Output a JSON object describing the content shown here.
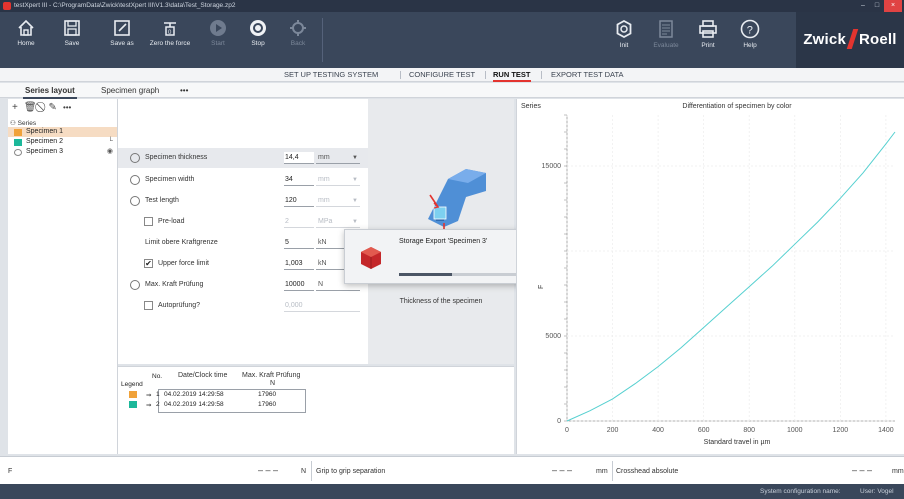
{
  "window": {
    "title": "testXpert III - C:\\ProgramData\\Zwick\\testXpert III\\V1.3\\data\\Test_Storage.zp2",
    "minimize": "–",
    "maximize": "□",
    "close": "×"
  },
  "toolbar": {
    "home": "Home",
    "save": "Save",
    "save_as": "Save as",
    "zero_force": "Zero the force",
    "start": "Start",
    "stop": "Stop",
    "back": "Back",
    "init": "Init",
    "evaluate": "Evaluate",
    "print": "Print",
    "help": "Help",
    "brand_left": "Zwick",
    "brand_right": "Roell"
  },
  "nav": {
    "tabs": [
      {
        "label": "SET UP TESTING SYSTEM"
      },
      {
        "label": "CONFIGURE TEST"
      },
      {
        "label": "RUN TEST"
      },
      {
        "label": "EXPORT TEST DATA"
      }
    ],
    "active": "RUN TEST"
  },
  "subtabs": {
    "series_layout": "Series layout",
    "specimen_graph": "Specimen graph",
    "more": "•••"
  },
  "tree": {
    "root": "Series",
    "items": [
      {
        "label": "Specimen 1",
        "color": "#f0a23a"
      },
      {
        "label": "Specimen 2",
        "color": "#1cb89a"
      },
      {
        "label": "Specimen 3",
        "color": "#ffffff"
      }
    ]
  },
  "settings": {
    "rows": [
      {
        "name": "Specimen thickness",
        "value": "14,4",
        "unit": "mm"
      },
      {
        "name": "Specimen width",
        "value": "34",
        "unit": "mm"
      },
      {
        "name": "Test length",
        "value": "120",
        "unit": "mm"
      },
      {
        "name": "Pre-load",
        "value": "2",
        "unit": "MPa"
      },
      {
        "name": "Limit obere Kraftgrenze",
        "value": "5",
        "unit": "kN"
      },
      {
        "name": "Upper force limit",
        "value": "1,003",
        "unit": "kN"
      },
      {
        "name": "Max. Kraft Prüfung",
        "value": "10000",
        "unit": "N"
      },
      {
        "name": "Autoprüfung?",
        "value": "0,000",
        "unit": ""
      }
    ]
  },
  "image_caption": "Thickness of the specimen",
  "popup": {
    "title": "Storage Export 'Specimen 3'",
    "progress": 0.3
  },
  "results": {
    "col_date": "Date/Clock time",
    "col_force": "Max. Kraft Prüfung",
    "col_force_unit": "N",
    "legend": "Legend",
    "no": "No.",
    "rows": [
      {
        "no": "1",
        "date": "04.02.2019 14:29:58",
        "force": "17960"
      },
      {
        "no": "2",
        "date": "04.02.2019 14:29:58",
        "force": "17960"
      }
    ]
  },
  "status": {
    "f_label": "F",
    "f_value": "– – –",
    "f_unit": "N",
    "grip": "Grip to grip separation",
    "grip_value": "– – –",
    "grip_unit": "mm",
    "crosshead": "Crosshead absolute",
    "crosshead_value": "– – –",
    "crosshead_unit": "mm"
  },
  "bottombar": {
    "system": "System configuration name:",
    "user": "User: Vogel"
  },
  "chart_data": {
    "type": "line",
    "title": "Differentiation of specimen by color",
    "xlabel": "Standard travel in µm",
    "ylabel": "F",
    "series_label": "Series",
    "xlim": [
      0,
      1440
    ],
    "ylim": [
      0,
      18000
    ],
    "xticks": [
      0,
      200,
      400,
      600,
      800,
      1000,
      1200,
      1400
    ],
    "yticks": [
      0,
      5000,
      10000,
      15000
    ],
    "ytick_labels": [
      "0",
      "5000",
      "",
      "15000"
    ],
    "grid": true,
    "line_color": "#56d0d0",
    "series": [
      {
        "x": [
          0,
          100,
          200,
          300,
          400,
          500,
          600,
          700,
          800,
          900,
          1000,
          1100,
          1200,
          1300,
          1400,
          1440
        ],
        "y": [
          0,
          600,
          1300,
          2200,
          3200,
          4300,
          5500,
          6700,
          7900,
          9100,
          10400,
          11700,
          13100,
          14600,
          16300,
          17000
        ]
      }
    ]
  }
}
